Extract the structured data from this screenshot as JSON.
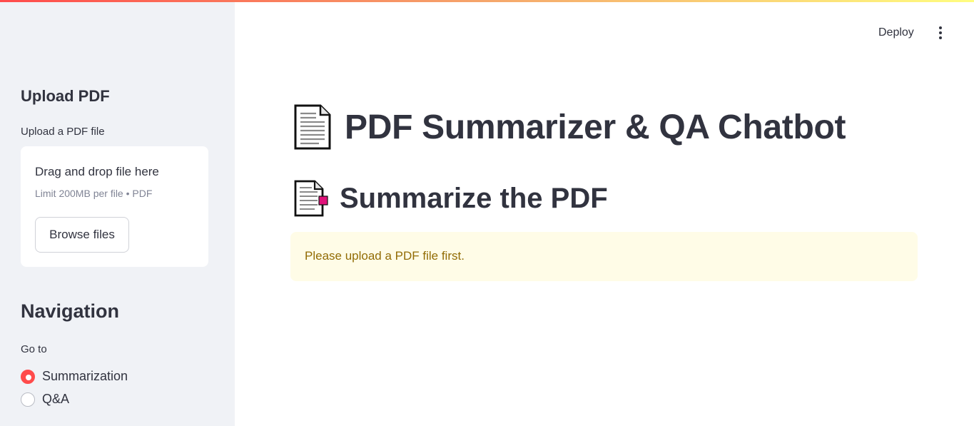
{
  "sidebar": {
    "upload_heading": "Upload PDF",
    "uploader_label": "Upload a PDF file",
    "uploader": {
      "drag_text": "Drag and drop file here",
      "limit_text": "Limit 200MB per file • PDF",
      "browse_label": "Browse files"
    },
    "nav_heading": "Navigation",
    "nav_label": "Go to",
    "nav_options": [
      {
        "label": "Summarization",
        "selected": true
      },
      {
        "label": "Q&A",
        "selected": false
      }
    ]
  },
  "header": {
    "deploy_label": "Deploy",
    "menu_icon": "kebab-menu-icon"
  },
  "main": {
    "title": "PDF Summarizer & QA Chatbot",
    "title_icon": "page-document-icon",
    "section_title": "Summarize the PDF",
    "section_icon": "bookmark-tab-document-icon",
    "alert_text": "Please upload a PDF file first."
  },
  "colors": {
    "accent": "#ff4b4b",
    "sidebar_bg": "#f0f2f6",
    "alert_bg": "#fffce7",
    "alert_text": "#926c05"
  }
}
